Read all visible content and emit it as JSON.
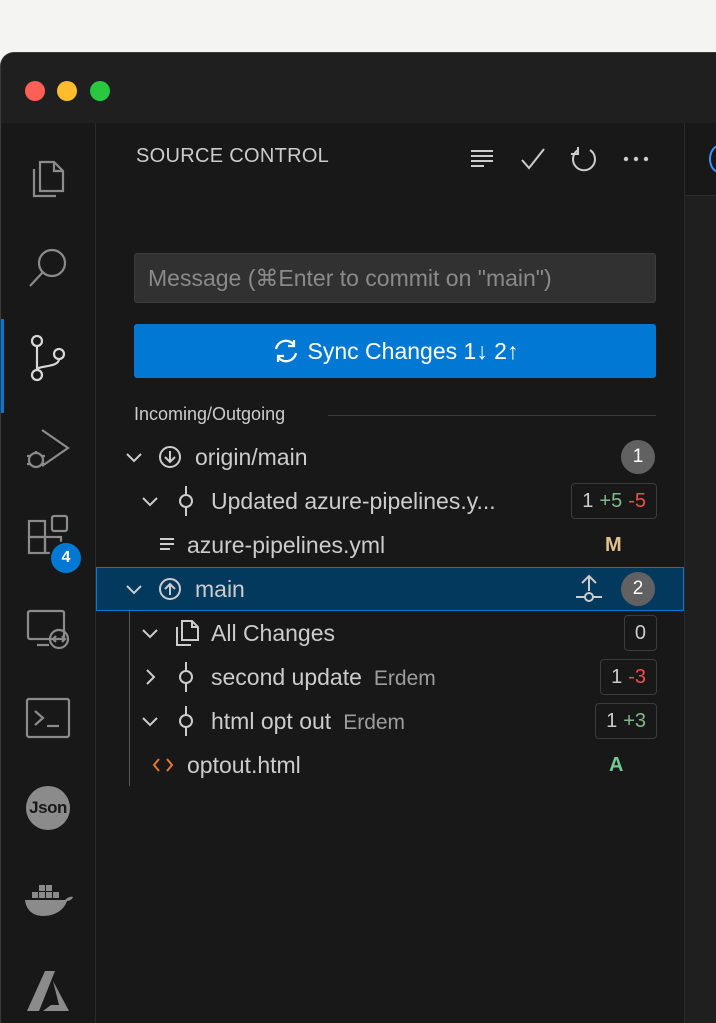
{
  "sidebar": {
    "title": "SOURCE CONTROL",
    "commit_placeholder": "Message (⌘Enter to commit on \"main\")",
    "sync_button": {
      "label": "Sync Changes 1↓ 2↑"
    },
    "section_title": "Incoming/Outgoing",
    "rows": {
      "origin": {
        "label": "origin/main",
        "count": "1"
      },
      "updated": {
        "label": "Updated azure-pipelines.y...",
        "files": "1",
        "added": "+5",
        "removed": "-5"
      },
      "azure": {
        "label": "azure-pipelines.yml",
        "decoration": "M"
      },
      "main": {
        "label": "main",
        "count": "2"
      },
      "allchanges": {
        "label": "All Changes",
        "count": "0"
      },
      "second": {
        "label": "second update",
        "author": "Erdem",
        "files": "1",
        "removed": "-3"
      },
      "htmlopt": {
        "label": "html opt out",
        "author": "Erdem",
        "files": "1",
        "added": "+3"
      },
      "optout": {
        "label": "optout.html",
        "decoration": "A"
      }
    }
  },
  "activity_bar": {
    "items": [
      "files-icon",
      "search-icon",
      "source-control-icon",
      "run-debug-icon",
      "extensions-icon",
      "remote-explorer-icon",
      "terminal-icon",
      "json-icon",
      "docker-icon",
      "azure-icon"
    ],
    "extensions_badge": "4",
    "json_label": "Json"
  },
  "colors": {
    "accent": "#0078d4",
    "selection": "#04395e",
    "added": "#81b88b",
    "deleted": "#f14c4c",
    "modified": "#e2c08d",
    "untracked_added": "#73c991"
  }
}
